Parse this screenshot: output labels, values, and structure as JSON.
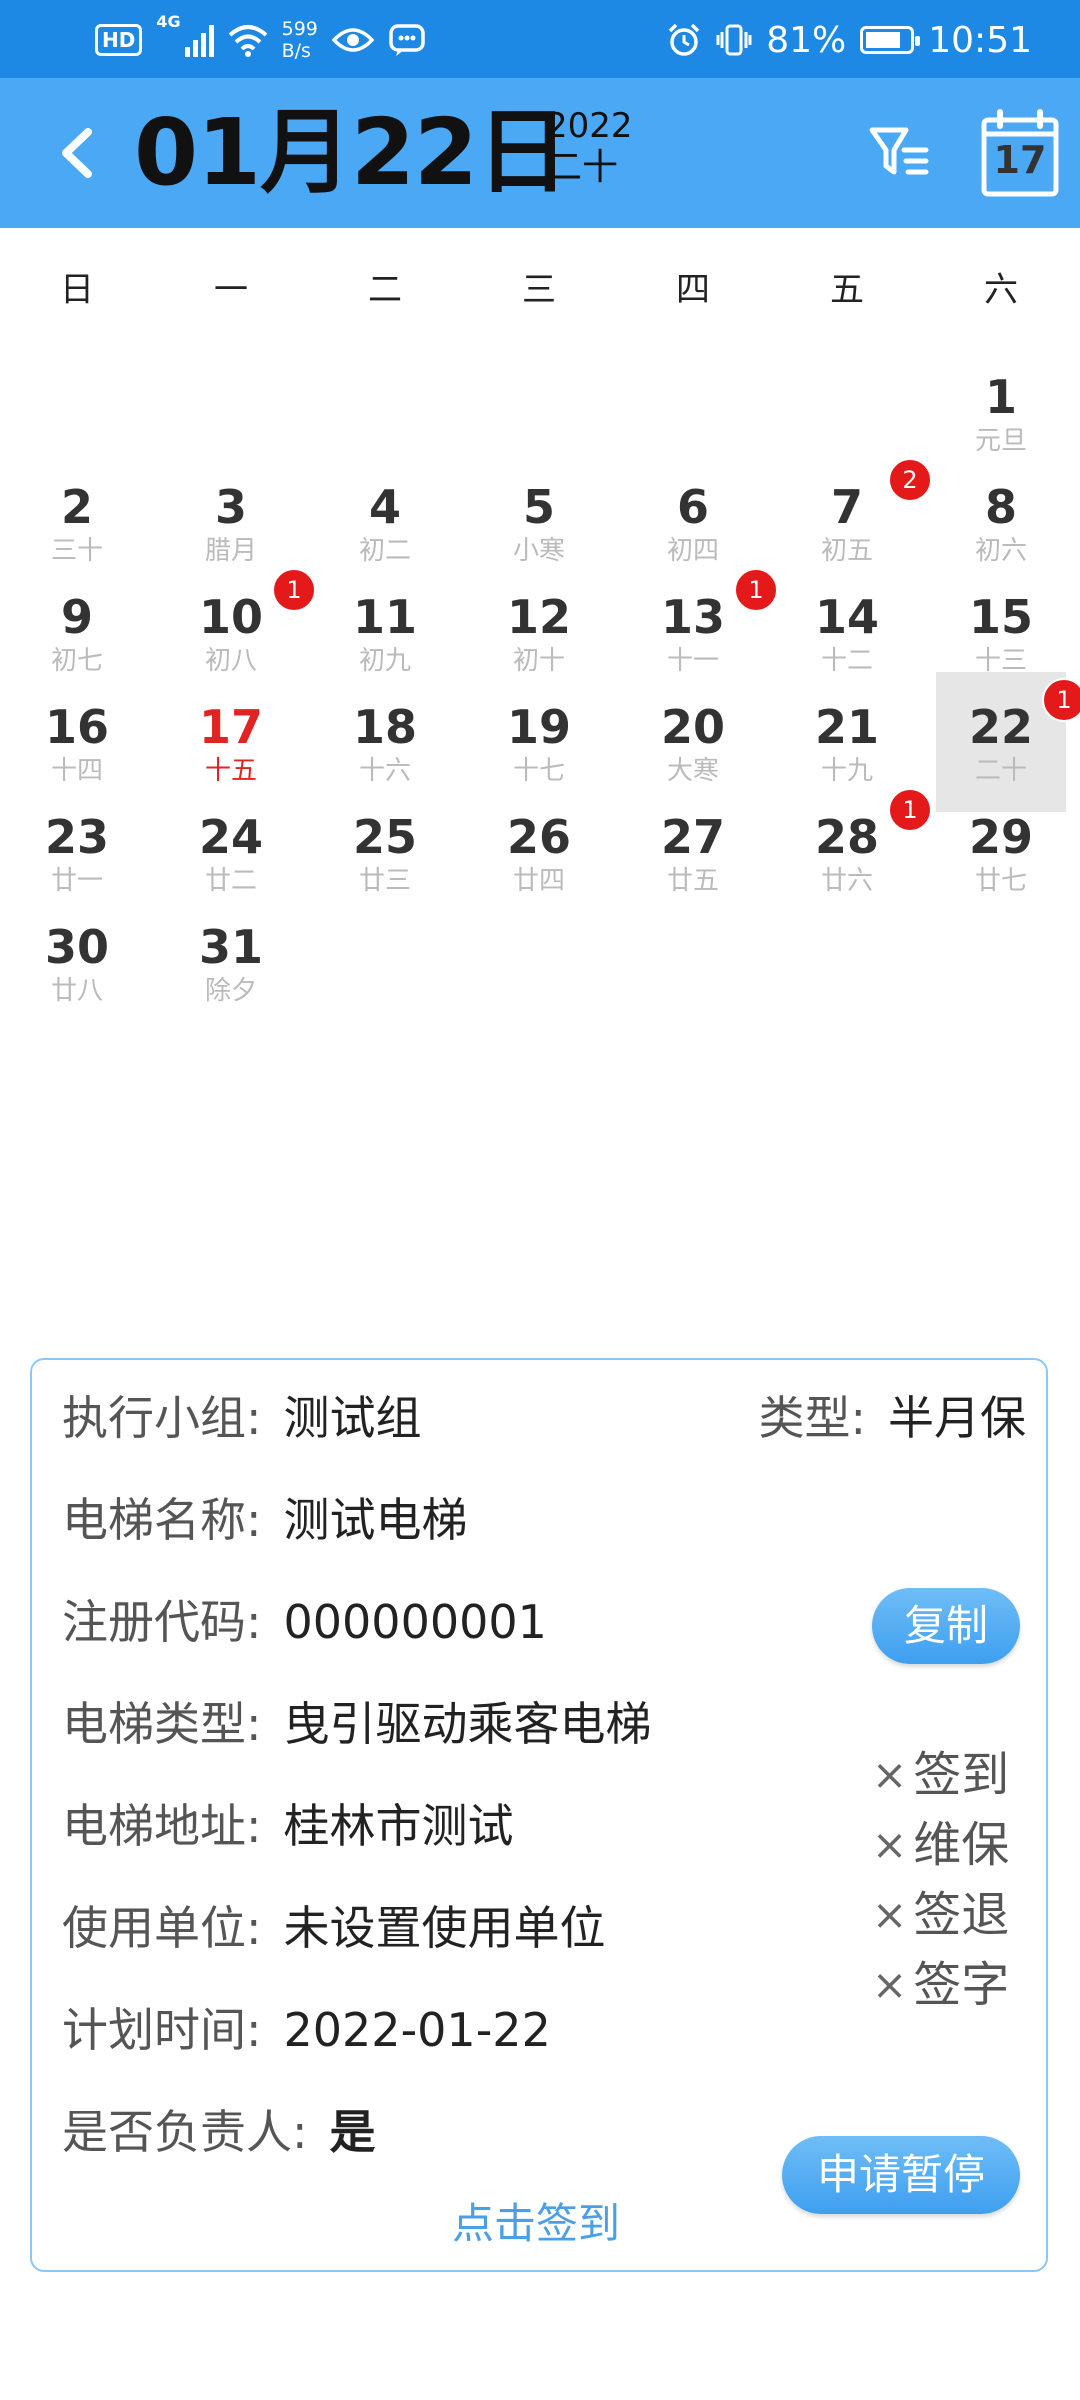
{
  "status_bar": {
    "hd": "HD",
    "network": "4G",
    "speed_value": "599",
    "speed_unit": "B/s",
    "battery": "81%",
    "battery_level": 0.81,
    "time": "10:51"
  },
  "header": {
    "date": "01月22日",
    "year": "2022",
    "lunar": "二十",
    "calendar_button": "17"
  },
  "weekdays": [
    "日",
    "一",
    "二",
    "三",
    "四",
    "五",
    "六"
  ],
  "calendar": {
    "days": [
      {
        "day": "1",
        "lunar": "元旦"
      },
      {
        "day": "2",
        "lunar": "三十"
      },
      {
        "day": "3",
        "lunar": "腊月"
      },
      {
        "day": "4",
        "lunar": "初二"
      },
      {
        "day": "5",
        "lunar": "小寒"
      },
      {
        "day": "6",
        "lunar": "初四"
      },
      {
        "day": "7",
        "lunar": "初五",
        "badge": "2"
      },
      {
        "day": "8",
        "lunar": "初六"
      },
      {
        "day": "9",
        "lunar": "初七"
      },
      {
        "day": "10",
        "lunar": "初八",
        "badge": "1"
      },
      {
        "day": "11",
        "lunar": "初九"
      },
      {
        "day": "12",
        "lunar": "初十"
      },
      {
        "day": "13",
        "lunar": "十一",
        "badge": "1"
      },
      {
        "day": "14",
        "lunar": "十二"
      },
      {
        "day": "15",
        "lunar": "十三"
      },
      {
        "day": "16",
        "lunar": "十四"
      },
      {
        "day": "17",
        "lunar": "十五",
        "today": true
      },
      {
        "day": "18",
        "lunar": "十六"
      },
      {
        "day": "19",
        "lunar": "十七"
      },
      {
        "day": "20",
        "lunar": "大寒"
      },
      {
        "day": "21",
        "lunar": "十九"
      },
      {
        "day": "22",
        "lunar": "二十",
        "badge": "1",
        "selected": true
      },
      {
        "day": "23",
        "lunar": "廿一"
      },
      {
        "day": "24",
        "lunar": "廿二"
      },
      {
        "day": "25",
        "lunar": "廿三"
      },
      {
        "day": "26",
        "lunar": "廿四"
      },
      {
        "day": "27",
        "lunar": "廿五"
      },
      {
        "day": "28",
        "lunar": "廿六",
        "badge": "1"
      },
      {
        "day": "29",
        "lunar": "廿七"
      },
      {
        "day": "30",
        "lunar": "廿八"
      },
      {
        "day": "31",
        "lunar": "除夕"
      }
    ]
  },
  "card": {
    "group_label": "执行小组:",
    "group_value": "测试组",
    "type_label": "类型:",
    "type_value": "半月保",
    "name_label": "电梯名称:",
    "name_value": "测试电梯",
    "code_label": "注册代码:",
    "code_value": "000000001",
    "copy_button": "复制",
    "elevator_type_label": "电梯类型:",
    "elevator_type_value": "曳引驱动乘客电梯",
    "address_label": "电梯地址:",
    "address_value": "桂林市测试",
    "unit_label": "使用单位:",
    "unit_value": "未设置使用单位",
    "plan_label": "计划时间:",
    "plan_value": "2022-01-22",
    "leader_label": "是否负责人:",
    "leader_value": "是",
    "status": [
      {
        "mark": "×",
        "label": "签到"
      },
      {
        "mark": "×",
        "label": "维保"
      },
      {
        "mark": "×",
        "label": "签退"
      },
      {
        "mark": "×",
        "label": "签字"
      }
    ],
    "pause_button": "申请暂停",
    "signin_link": "点击签到"
  }
}
